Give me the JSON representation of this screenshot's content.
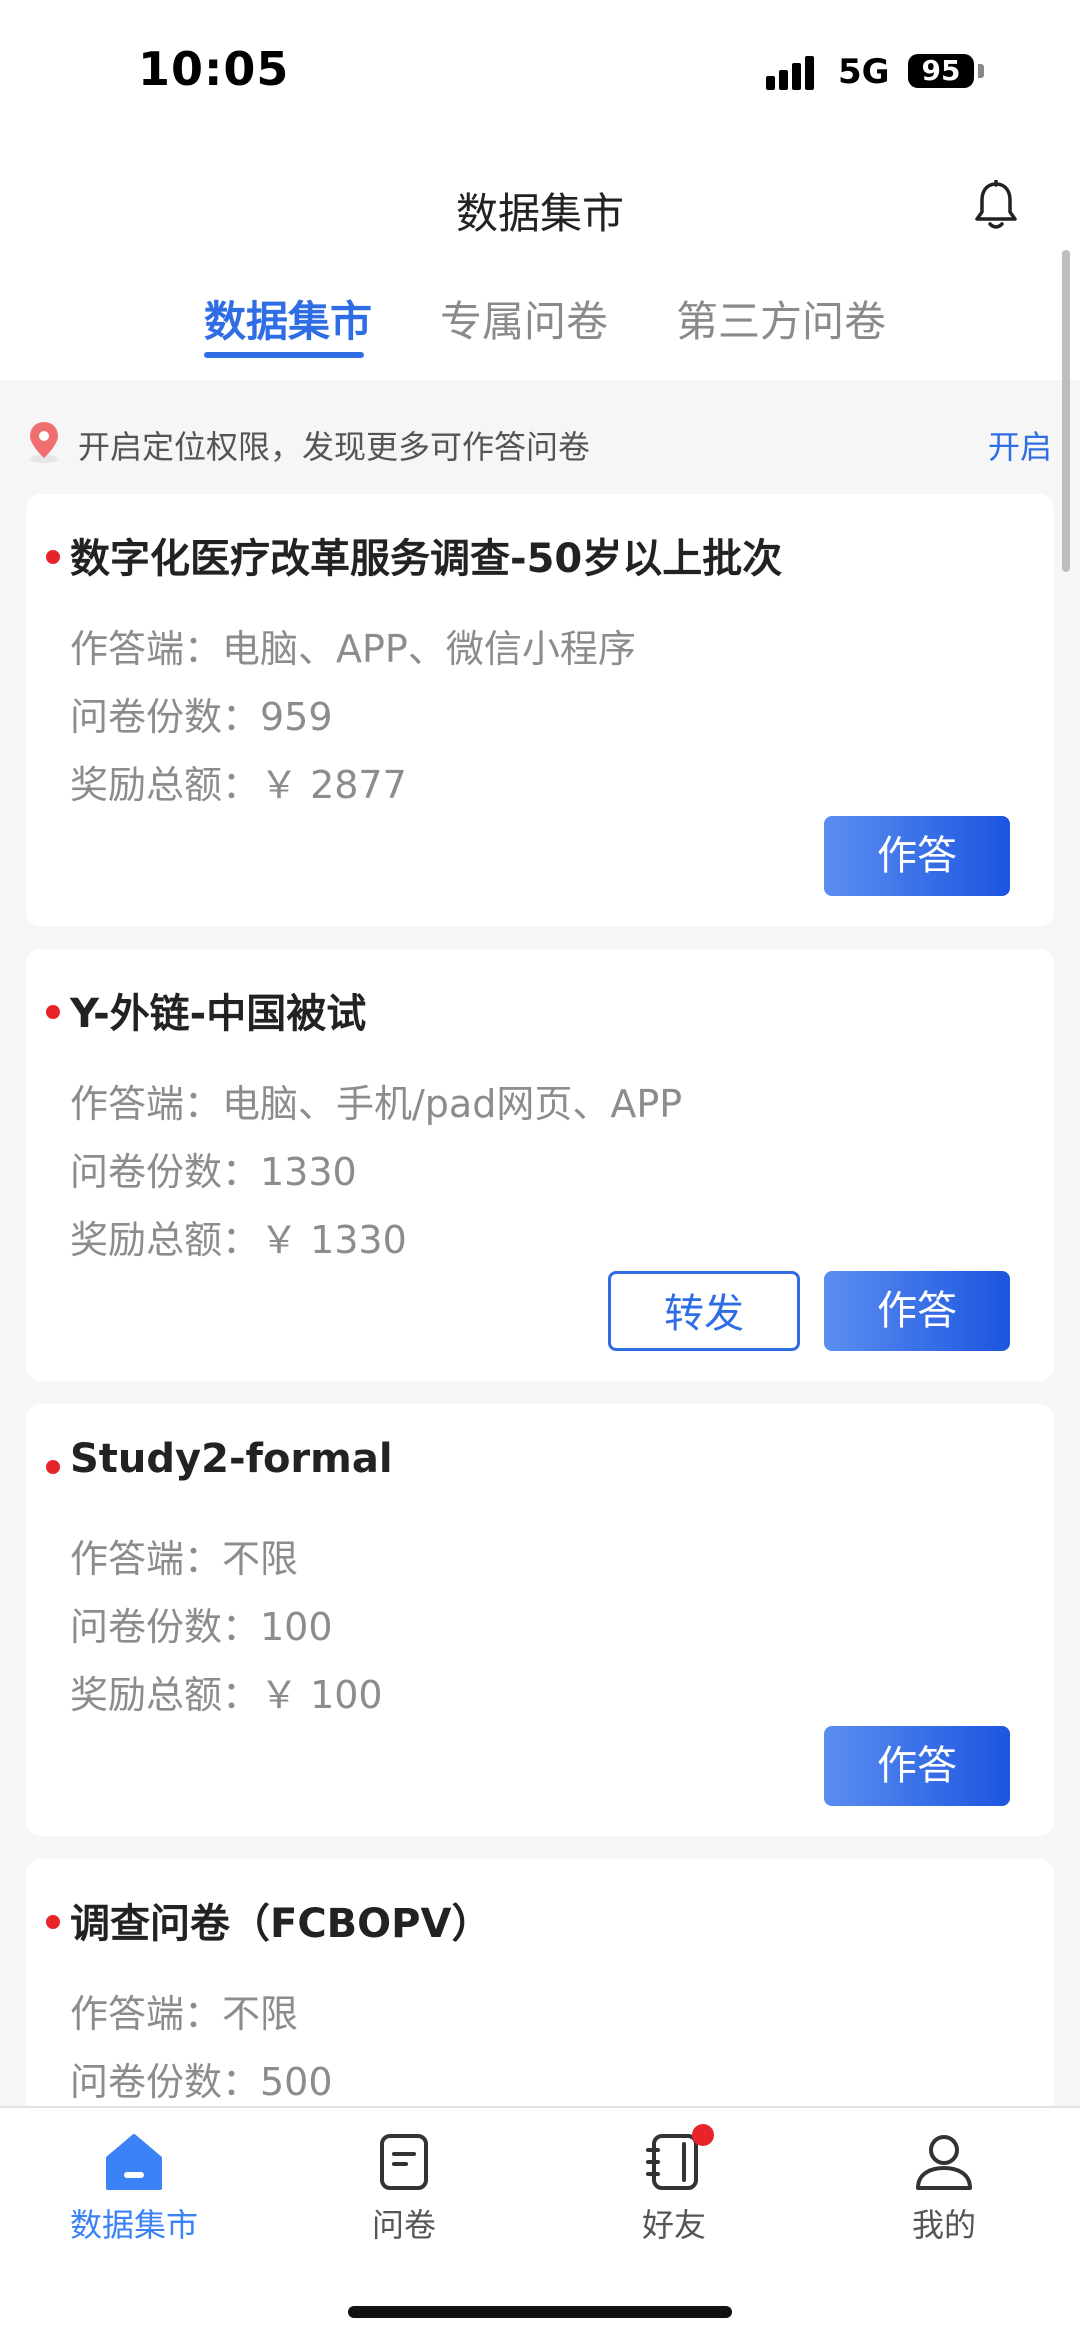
{
  "status_bar": {
    "time": "10:05",
    "network": "5G",
    "battery": "95"
  },
  "header": {
    "title": "数据集市",
    "tabs": [
      {
        "label": "数据集市",
        "active": true
      },
      {
        "label": "专属问卷",
        "active": false
      },
      {
        "label": "第三方问卷",
        "active": false
      }
    ],
    "icons": {
      "bell": "bell-icon"
    }
  },
  "location": {
    "text": "开启定位权限，发现更多可作答问卷",
    "action": "开启"
  },
  "cards": [
    {
      "title": "数字化医疗改革服务调查-50岁以上批次",
      "platform": "作答端：电脑、APP、微信小程序",
      "count": "问卷份数：959",
      "reward": "奖励总额：￥ 2877",
      "answer_label": "作答"
    },
    {
      "title": "Y-外链-中国被试",
      "platform": "作答端：电脑、手机/pad网页、APP",
      "count": "问卷份数：1330",
      "reward": "奖励总额：￥ 1330",
      "share_label": "转发",
      "answer_label": "作答"
    },
    {
      "title": "Study2-formal",
      "platform": "作答端：不限",
      "count": "问卷份数：100",
      "reward": "奖励总额：￥ 100",
      "answer_label": "作答"
    },
    {
      "title": "调查问卷（FCBOPV）",
      "platform": "作答端：不限",
      "count": "问卷份数：500"
    }
  ],
  "bottom_nav": [
    {
      "label": "数据集市",
      "icon": "home-icon",
      "active": true
    },
    {
      "label": "问卷",
      "icon": "questionnaire-icon",
      "active": false
    },
    {
      "label": "好友",
      "icon": "friends-icon",
      "active": false
    },
    {
      "label": "我的",
      "icon": "profile-icon",
      "active": false
    }
  ],
  "colors": {
    "accent": "#2f6de4",
    "badge": "#e8242b",
    "nav_active": "#3b82f6"
  }
}
